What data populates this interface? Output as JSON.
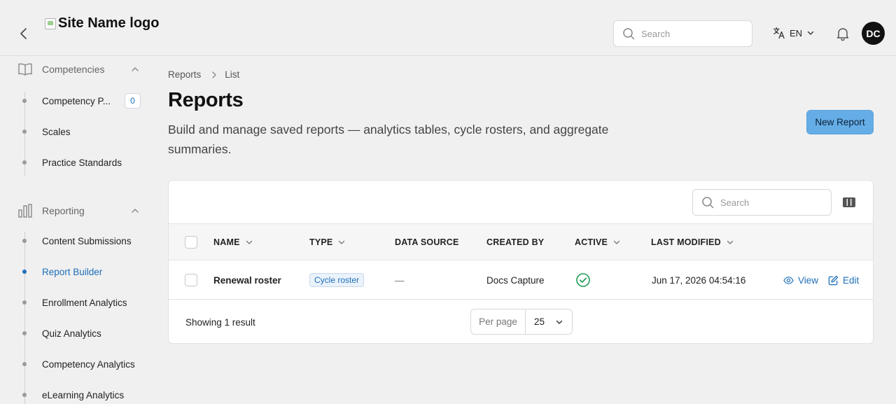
{
  "header": {
    "logo_alt": "Site Name logo",
    "search_placeholder": "Search",
    "language": "EN",
    "avatar_initials": "DC"
  },
  "sidebar": {
    "groups": [
      {
        "label": "Competencies",
        "icon": "book-icon",
        "items": [
          {
            "label": "Competency P...",
            "badge": "0"
          },
          {
            "label": "Scales"
          },
          {
            "label": "Practice Standards"
          }
        ]
      },
      {
        "label": "Reporting",
        "icon": "bar-chart-icon",
        "items": [
          {
            "label": "Content Submissions"
          },
          {
            "label": "Report Builder",
            "active": true
          },
          {
            "label": "Enrollment Analytics"
          },
          {
            "label": "Quiz Analytics"
          },
          {
            "label": "Competency Analytics"
          },
          {
            "label": "eLearning Analytics"
          }
        ]
      }
    ]
  },
  "breadcrumb": [
    "Reports",
    "List"
  ],
  "page": {
    "title": "Reports",
    "description": "Build and manage saved reports — analytics tables, cycle rosters, and aggregate summaries.",
    "new_button": "New Report"
  },
  "table": {
    "search_placeholder": "Search",
    "columns": [
      "NAME",
      "TYPE",
      "DATA SOURCE",
      "CREATED BY",
      "ACTIVE",
      "LAST MODIFIED"
    ],
    "rows": [
      {
        "name": "Renewal roster",
        "type": "Cycle roster",
        "data_source": "—",
        "created_by": "Docs Capture",
        "active": true,
        "last_modified": "Jun 17, 2026 04:54:16",
        "actions": [
          "View",
          "Edit"
        ]
      }
    ],
    "result_text": "Showing 1 result",
    "per_page_label": "Per page",
    "per_page_value": "25"
  },
  "colors": {
    "accent": "#1e6fb8",
    "primary_button": "#65ade6",
    "success": "#1f9d55"
  }
}
